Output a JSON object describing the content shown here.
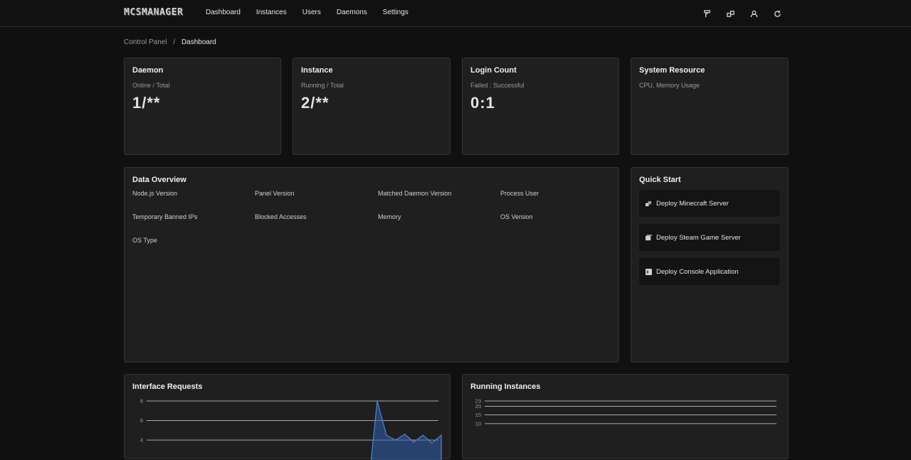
{
  "header": {
    "logo": "MCSMANAGER",
    "nav": [
      "Dashboard",
      "Instances",
      "Users",
      "Daemons",
      "Settings"
    ],
    "right_icons": [
      "paint-roller-icon",
      "puzzle-icon",
      "user-icon",
      "refresh-icon"
    ]
  },
  "breadcrumb": {
    "root": "Control Panel",
    "separator": "/",
    "current": "Dashboard"
  },
  "stats": {
    "daemon": {
      "title": "Daemon",
      "subtitle": "Online / Total",
      "value": "1/**"
    },
    "instance": {
      "title": "Instance",
      "subtitle": "Running / Total",
      "value": "2/**"
    },
    "login": {
      "title": "Login Count",
      "subtitle": "Failed : Successful",
      "value": "0:1"
    },
    "system": {
      "title": "System Resource",
      "subtitle": "CPU, Memory Usage"
    }
  },
  "overview": {
    "title": "Data Overview",
    "labels": [
      "Node.js Version",
      "Panel Version",
      "Matched Daemon Version",
      "Process User",
      "Temporary Banned IPs",
      "Blocked Accesses",
      "Memory",
      "OS Version",
      "OS Type"
    ]
  },
  "quickstart": {
    "title": "Quick Start",
    "items": [
      {
        "label": "Deploy Minecraft Server",
        "icon": "cubes-icon"
      },
      {
        "label": "Deploy Steam Game Server",
        "icon": "stack-icon"
      },
      {
        "label": "Deploy Console Application",
        "icon": "terminal-icon"
      }
    ]
  },
  "chart_data": [
    {
      "type": "area",
      "title": "Interface Requests",
      "yticks": [
        "8",
        "6",
        "4"
      ],
      "ylim": [
        4,
        8
      ],
      "series": [
        {
          "values": [
            0,
            0,
            0,
            0,
            0,
            0,
            0,
            0,
            0,
            0,
            0,
            0,
            0,
            0,
            0,
            0,
            0,
            0,
            0,
            0,
            0,
            0,
            0,
            0,
            0,
            0,
            0,
            8,
            4.5,
            4,
            4.6,
            3.8,
            4.5,
            3.7,
            4.5
          ]
        }
      ]
    },
    {
      "type": "line",
      "title": "Running Instances",
      "yticks": [
        "23",
        "20",
        "15",
        "10"
      ],
      "ylim": [
        10,
        23
      ]
    }
  ]
}
